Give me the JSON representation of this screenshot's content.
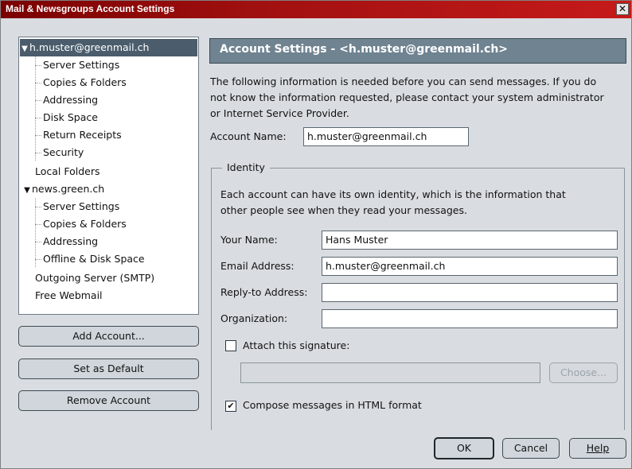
{
  "window": {
    "title": "Mail & Newsgroups Account Settings",
    "close_symbol": "✕"
  },
  "tree": {
    "account1": "h.muster@greenmail.ch",
    "account1_items": [
      "Server Settings",
      "Copies & Folders",
      "Addressing",
      "Disk Space",
      "Return Receipts",
      "Security"
    ],
    "local_folders": "Local Folders",
    "account2": "news.green.ch",
    "account2_items": [
      "Server Settings",
      "Copies & Folders",
      "Addressing",
      "Offline & Disk Space"
    ],
    "outgoing": "Outgoing Server (SMTP)",
    "webmail": "Free Webmail",
    "expanded_symbol": "▼"
  },
  "left_buttons": {
    "add": "Add Account...",
    "default": "Set as Default",
    "remove": "Remove Account"
  },
  "panel": {
    "header": "Account Settings - <h.muster@greenmail.ch>",
    "intro_line1": "The following information is needed before you can send messages. If you do",
    "intro_line2": "not know the information requested, please contact your system administrator",
    "intro_line3": "or Internet Service Provider.",
    "account_name_label": "Account Name:",
    "account_name_value": "h.muster@greenmail.ch",
    "identity_legend": "Identity",
    "identity_line1": "Each account can have its own identity, which is the information that",
    "identity_line2": "other people see when they read your messages.",
    "your_name_label": "Your Name:",
    "your_name_value": "Hans Muster",
    "email_label": "Email Address:",
    "email_value": "h.muster@greenmail.ch",
    "reply_label": "Reply-to Address:",
    "reply_value": "",
    "org_label": "Organization:",
    "org_value": "",
    "attach_sig_label": "Attach this signature:",
    "attach_sig_checked": false,
    "signature_path": "",
    "choose_label": "Choose...",
    "compose_html_label": "Compose messages in HTML format",
    "compose_html_checked": true,
    "check_mark": "✔"
  },
  "dialog_buttons": {
    "ok": "OK",
    "cancel": "Cancel",
    "help": "Help"
  }
}
